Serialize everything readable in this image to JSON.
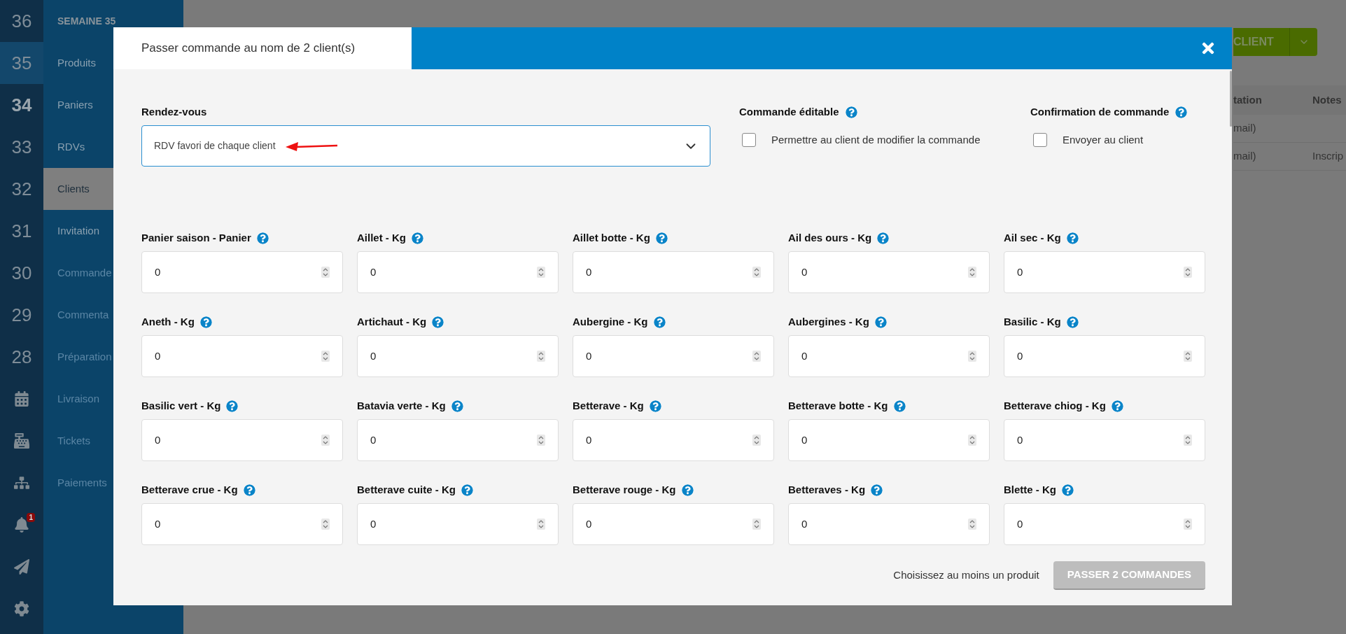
{
  "sidebar": {
    "weeks": [
      {
        "label": "36",
        "selected": false,
        "current": false
      },
      {
        "label": "35",
        "selected": true,
        "current": false
      },
      {
        "label": "34",
        "selected": false,
        "current": true
      },
      {
        "label": "33",
        "selected": false,
        "current": false
      },
      {
        "label": "32",
        "selected": false,
        "current": false
      },
      {
        "label": "31",
        "selected": false,
        "current": false
      },
      {
        "label": "30",
        "selected": false,
        "current": false
      },
      {
        "label": "29",
        "selected": false,
        "current": false
      },
      {
        "label": "28",
        "selected": false,
        "current": false
      }
    ],
    "notification_badge": "1"
  },
  "nav": {
    "heading": "SEMAINE 35",
    "items": [
      {
        "label": "Produits",
        "selected": false,
        "disabled": false
      },
      {
        "label": "Paniers",
        "selected": false,
        "disabled": false
      },
      {
        "label": "RDVs",
        "selected": false,
        "disabled": false
      },
      {
        "label": "Clients",
        "selected": true,
        "disabled": false
      },
      {
        "label": "Invitation",
        "selected": false,
        "disabled": false
      },
      {
        "label": "Commande",
        "selected": false,
        "disabled": true
      },
      {
        "label": "Commenta",
        "selected": false,
        "disabled": true
      },
      {
        "label": "Préparation",
        "selected": false,
        "disabled": true
      },
      {
        "label": "Livraison",
        "selected": false,
        "disabled": true
      },
      {
        "label": "Tickets",
        "selected": false,
        "disabled": true
      },
      {
        "label": "Paiements",
        "selected": false,
        "disabled": true
      }
    ]
  },
  "background": {
    "button": "CLIENT",
    "table": {
      "columns": [
        "tation",
        "Notes"
      ],
      "rows": [
        {
          "column_1": "mail)"
        },
        {
          "column_1": "mail)",
          "column_2": "Inscrip"
        }
      ]
    }
  },
  "modal": {
    "title": "Passer commande au nom de 2 client(s)",
    "rendezvous": {
      "label": "Rendez-vous",
      "value": "RDV favori de chaque client"
    },
    "options": [
      {
        "title": "Commande éditable",
        "label": "Permettre au client de modifier la commande",
        "checked": false
      },
      {
        "title": "Confirmation de commande",
        "label": "Envoyer au client",
        "checked": false
      }
    ],
    "products": [
      {
        "label": "Panier saison - Panier",
        "value": "0"
      },
      {
        "label": "Aillet - Kg",
        "value": "0"
      },
      {
        "label": "Aillet botte - Kg",
        "value": "0"
      },
      {
        "label": "Ail des ours - Kg",
        "value": "0"
      },
      {
        "label": "Ail sec - Kg",
        "value": "0"
      },
      {
        "label": "Aneth - Kg",
        "value": "0"
      },
      {
        "label": "Artichaut - Kg",
        "value": "0"
      },
      {
        "label": "Aubergine - Kg",
        "value": "0"
      },
      {
        "label": "Aubergines - Kg",
        "value": "0"
      },
      {
        "label": "Basilic - Kg",
        "value": "0"
      },
      {
        "label": "Basilic vert - Kg",
        "value": "0"
      },
      {
        "label": "Batavia verte - Kg",
        "value": "0"
      },
      {
        "label": "Betterave - Kg",
        "value": "0"
      },
      {
        "label": "Betterave botte - Kg",
        "value": "0"
      },
      {
        "label": "Betterave chiog - Kg",
        "value": "0"
      },
      {
        "label": "Betterave crue - Kg",
        "value": "0"
      },
      {
        "label": "Betterave cuite - Kg",
        "value": "0"
      },
      {
        "label": "Betterave rouge - Kg",
        "value": "0"
      },
      {
        "label": "Betteraves - Kg",
        "value": "0"
      },
      {
        "label": "Blette - Kg",
        "value": "0"
      }
    ],
    "footer": {
      "hint": "Choisissez au moins un produit",
      "button": "PASSER 2 COMMANDES",
      "disabled": true
    }
  }
}
